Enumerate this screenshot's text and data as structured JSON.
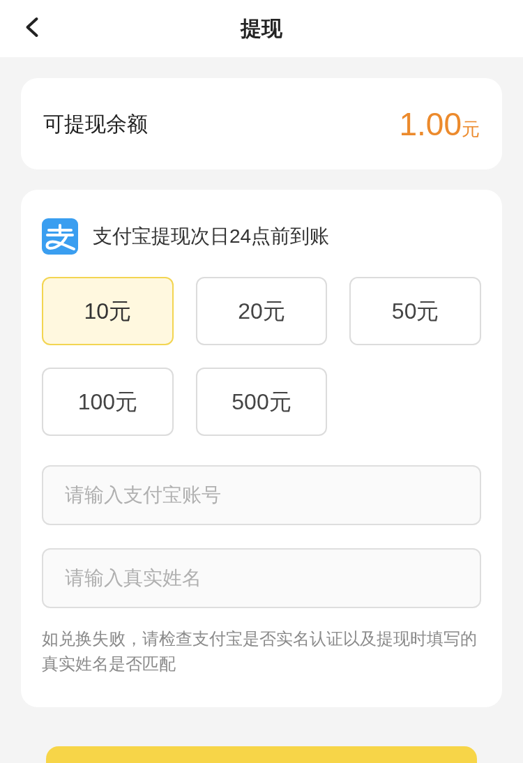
{
  "header": {
    "title": "提现"
  },
  "balance": {
    "label": "可提现余额",
    "amount": "1.00",
    "unit": "元"
  },
  "withdraw": {
    "method": "支付宝提现次日24点前到账",
    "amounts": [
      {
        "label": "10元",
        "selected": true
      },
      {
        "label": "20元",
        "selected": false
      },
      {
        "label": "50元",
        "selected": false
      },
      {
        "label": "100元",
        "selected": false
      },
      {
        "label": "500元",
        "selected": false
      }
    ],
    "fields": [
      {
        "placeholder": "请输入支付宝账号"
      },
      {
        "placeholder": "请输入真实姓名"
      }
    ],
    "note": "如兑换失败，请检查支付宝是否实名认证以及提现时填写的真实姓名是否匹配"
  }
}
